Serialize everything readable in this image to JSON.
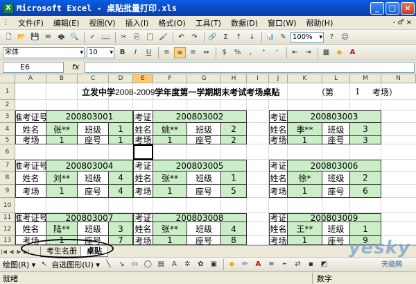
{
  "window": {
    "title": "Microsoft Excel - 桌贴批量打印.xls",
    "app_icon": "X",
    "min": "_",
    "max": "□",
    "close": "×"
  },
  "menu": {
    "items": [
      "文件(F)",
      "编辑(E)",
      "视图(V)",
      "插入(I)",
      "格式(O)",
      "工具(T)",
      "数据(D)",
      "窗口(W)",
      "帮助(H)"
    ],
    "right_close": "- ♂ ×"
  },
  "toolbar": {
    "zoom": "100%",
    "font": "宋体",
    "size": "10"
  },
  "formula": {
    "namebox": "E6",
    "fx": "fx",
    "value": ""
  },
  "columns": [
    "A",
    "B",
    "C",
    "D",
    "E",
    "F",
    "G",
    "H",
    "I",
    "J",
    "K",
    "L",
    "M",
    "N"
  ],
  "rows": [
    "1",
    "2",
    "3",
    "4",
    "5",
    "6",
    "7",
    "8",
    "9",
    "10",
    "11",
    "12",
    "13"
  ],
  "heading": {
    "prefix": "立发中学",
    "years": "2008-2009",
    "suffix": "学年度第一学期期末考试考场桌贴",
    "open": "（第",
    "num": "1",
    "close": "考场）"
  },
  "labels": {
    "ticket": "准考证号",
    "name": "姓名",
    "class": "班级",
    "room": "考场",
    "seat": "座号"
  },
  "cards": [
    {
      "ticket": "200803001",
      "name": "张**",
      "class": "1",
      "room": "1",
      "seat": "1"
    },
    {
      "ticket": "200803002",
      "name": "姚**",
      "class": "2",
      "room": "1",
      "seat": "2"
    },
    {
      "ticket": "200803003",
      "name": "季**",
      "class": "3",
      "room": "1",
      "seat": "3"
    },
    {
      "ticket": "200803004",
      "name": "刘**",
      "class": "4",
      "room": "1",
      "seat": "4"
    },
    {
      "ticket": "200803005",
      "name": "张**",
      "class": "1",
      "room": "1",
      "seat": "5"
    },
    {
      "ticket": "200803006",
      "name": "徐*",
      "class": "2",
      "room": "1",
      "seat": "6"
    },
    {
      "ticket": "200803007",
      "name": "陆**",
      "class": "3",
      "room": "1",
      "seat": "7"
    },
    {
      "ticket": "200803008",
      "name": "张**",
      "class": "4",
      "room": "1",
      "seat": "8"
    },
    {
      "ticket": "200803009",
      "name": "王**",
      "class": "1",
      "room": "1",
      "seat": "9"
    }
  ],
  "sheets": [
    "考生名册",
    "桌贴"
  ],
  "drawbar": {
    "draw": "绘图(R) ▾",
    "autoshape": "自选图形(U) ▾"
  },
  "status": {
    "ready": "就绪",
    "num": "数字"
  },
  "watermark": {
    "logo": "yesky",
    "sub": "天极网"
  },
  "colors": {
    "card_green": "#cbeec8",
    "titlebar": "#0b4bc6"
  }
}
